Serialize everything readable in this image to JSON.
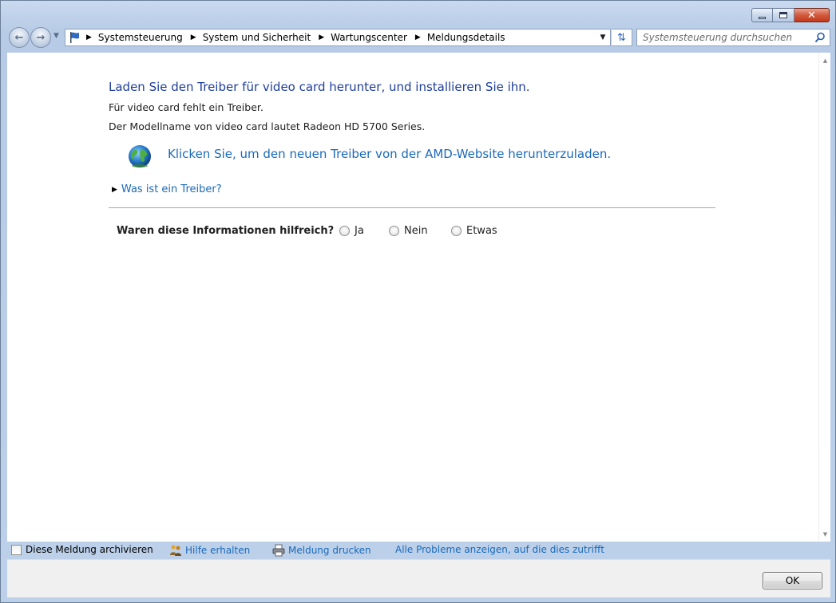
{
  "window": {
    "minimize_label": "–",
    "maximize_label": "□",
    "close_label": "✕"
  },
  "nav": {
    "breadcrumbs": [
      "Systemsteuerung",
      "System und Sicherheit",
      "Wartungscenter",
      "Meldungsdetails"
    ],
    "search_placeholder": "Systemsteuerung durchsuchen"
  },
  "content": {
    "heading": "Laden Sie den Treiber für video card herunter, und installieren Sie ihn.",
    "line1": "Für video card fehlt ein Treiber.",
    "line2": "Der Modellname von video card lautet Radeon HD 5700 Series.",
    "download_link": "Klicken Sie, um den neuen Treiber von der AMD-Website herunterzuladen.",
    "expander_label": "Was ist ein Treiber?",
    "question": "Waren diese Informationen hilfreich?",
    "options": [
      "Ja",
      "Nein",
      "Etwas"
    ]
  },
  "footer": {
    "archive_label": "Diese Meldung archivieren",
    "help_label": "Hilfe erhalten",
    "print_label": "Meldung drucken",
    "all_problems_label": "Alle Probleme anzeigen, auf die dies zutrifft"
  },
  "buttons": {
    "ok": "OK"
  },
  "colors": {
    "link": "#1a6ab8",
    "heading": "#1e3e9b",
    "frame": "#bcd0ea"
  }
}
